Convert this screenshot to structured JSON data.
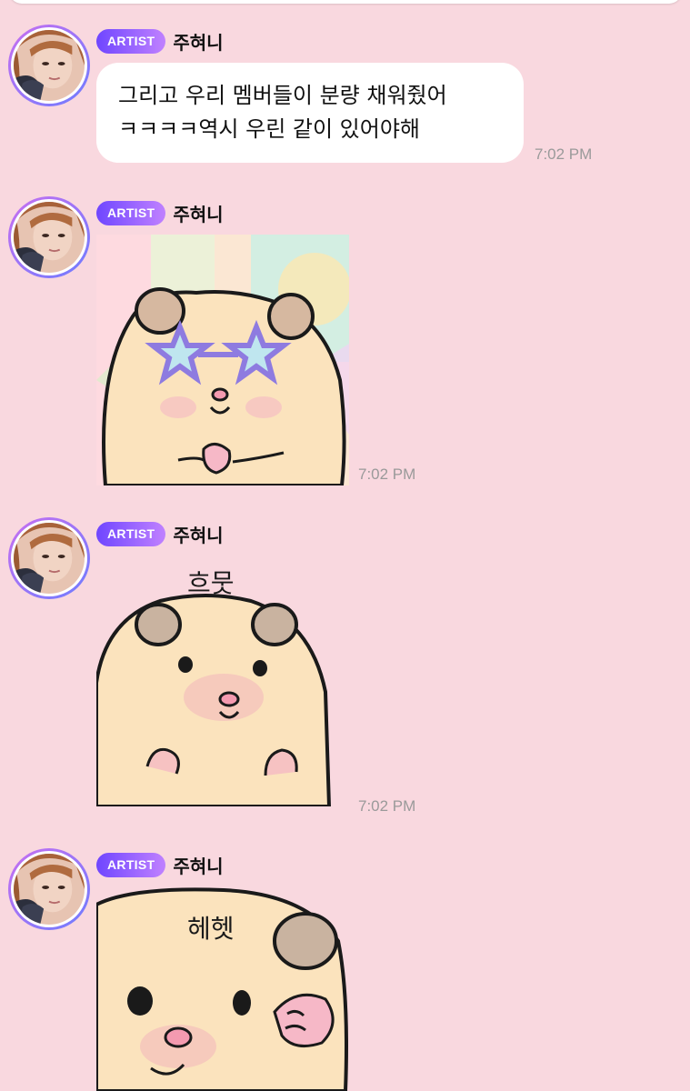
{
  "messages": [
    {
      "badge": "ARTIST",
      "sender": "주혀니",
      "text_lines": [
        "그리고 우리 멤버들이 분량 채워줬어",
        "ㅋㅋㅋㅋ역시 우린 같이 있어야해"
      ],
      "time": "7:02 PM"
    },
    {
      "badge": "ARTIST",
      "sender": "주혀니",
      "sticker": "hamster-star-sunglasses",
      "time": "7:02 PM"
    },
    {
      "badge": "ARTIST",
      "sender": "주혀니",
      "sticker": "hamster-proud",
      "sticker_text": "흐뭇",
      "time": "7:02 PM"
    },
    {
      "badge": "ARTIST",
      "sender": "주혀니",
      "sticker": "hamster-hehe",
      "sticker_text": "헤헷"
    }
  ]
}
